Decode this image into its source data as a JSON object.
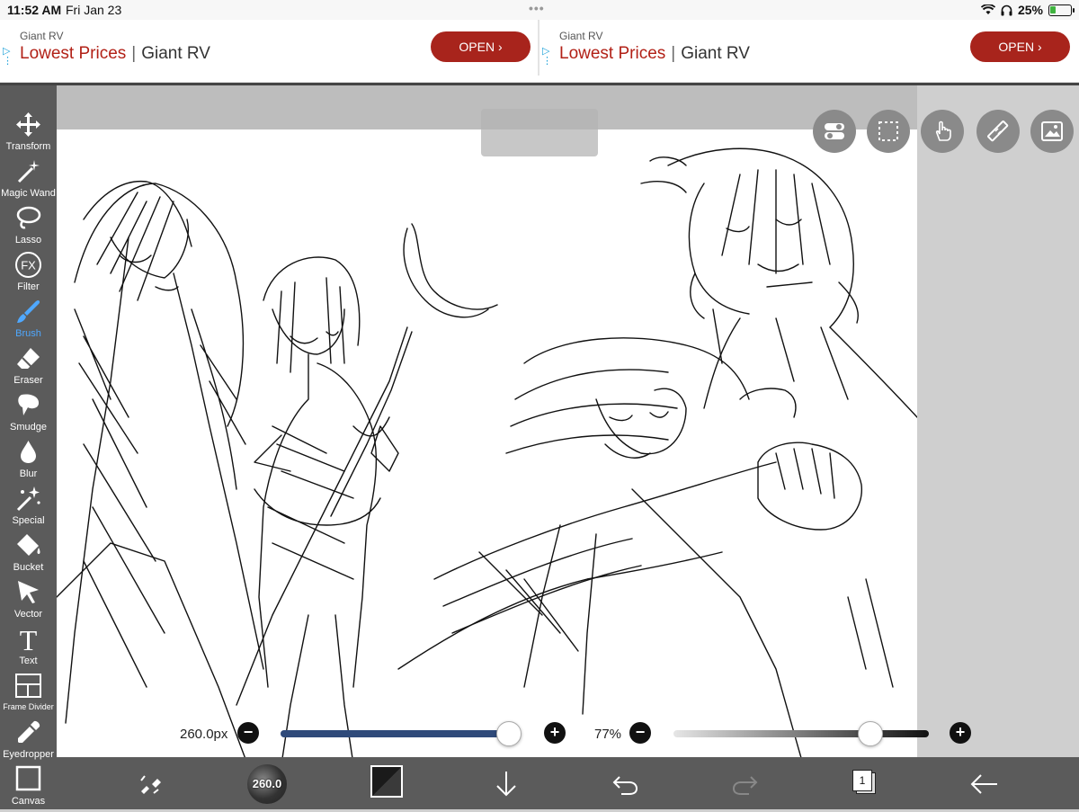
{
  "status_bar": {
    "time": "11:52 AM",
    "date": "Fri Jan 23",
    "battery_percent": "25%",
    "battery_level": 0.25
  },
  "ads": [
    {
      "brand": "Giant RV",
      "headline_red": "Lowest Prices",
      "separator": "|",
      "headline_name": "Giant RV",
      "button": "OPEN ›"
    },
    {
      "brand": "Giant RV",
      "headline_red": "Lowest Prices",
      "separator": "|",
      "headline_name": "Giant RV",
      "button": "OPEN ›"
    }
  ],
  "tools": [
    {
      "name": "transform",
      "label": "Transform",
      "icon": "move-arrows-icon"
    },
    {
      "name": "magic-wand",
      "label": "Magic Wand",
      "icon": "magic-wand-icon"
    },
    {
      "name": "lasso",
      "label": "Lasso",
      "icon": "lasso-icon"
    },
    {
      "name": "filter",
      "label": "Filter",
      "icon": "fx-icon"
    },
    {
      "name": "brush",
      "label": "Brush",
      "icon": "brush-icon",
      "active": true
    },
    {
      "name": "eraser",
      "label": "Eraser",
      "icon": "eraser-icon"
    },
    {
      "name": "smudge",
      "label": "Smudge",
      "icon": "smudge-icon"
    },
    {
      "name": "blur",
      "label": "Blur",
      "icon": "drop-icon"
    },
    {
      "name": "special",
      "label": "Special",
      "icon": "sparkle-icon"
    },
    {
      "name": "bucket",
      "label": "Bucket",
      "icon": "bucket-icon"
    },
    {
      "name": "vector",
      "label": "Vector",
      "icon": "cursor-icon"
    },
    {
      "name": "text",
      "label": "Text",
      "icon": "text-icon"
    },
    {
      "name": "frame-divider",
      "label": "Frame Divider",
      "icon": "frame-divider-icon"
    },
    {
      "name": "eyedropper",
      "label": "Eyedropper",
      "icon": "eyedropper-icon"
    },
    {
      "name": "canvas",
      "label": "Canvas",
      "icon": "canvas-icon"
    }
  ],
  "fx_glyph": "FX",
  "text_glyph": "T",
  "sliders": {
    "brush_size": {
      "value_label": "260.0px",
      "level": 0.95
    },
    "opacity": {
      "value_label": "77%",
      "level": 0.77
    }
  },
  "bottom_bar": {
    "brush_size_label": "260.0",
    "layer_count": "1"
  },
  "colors": {
    "accent_blue": "#4fa8ff",
    "ad_red": "#a8241c",
    "panel_gray": "#5b5b5b"
  }
}
